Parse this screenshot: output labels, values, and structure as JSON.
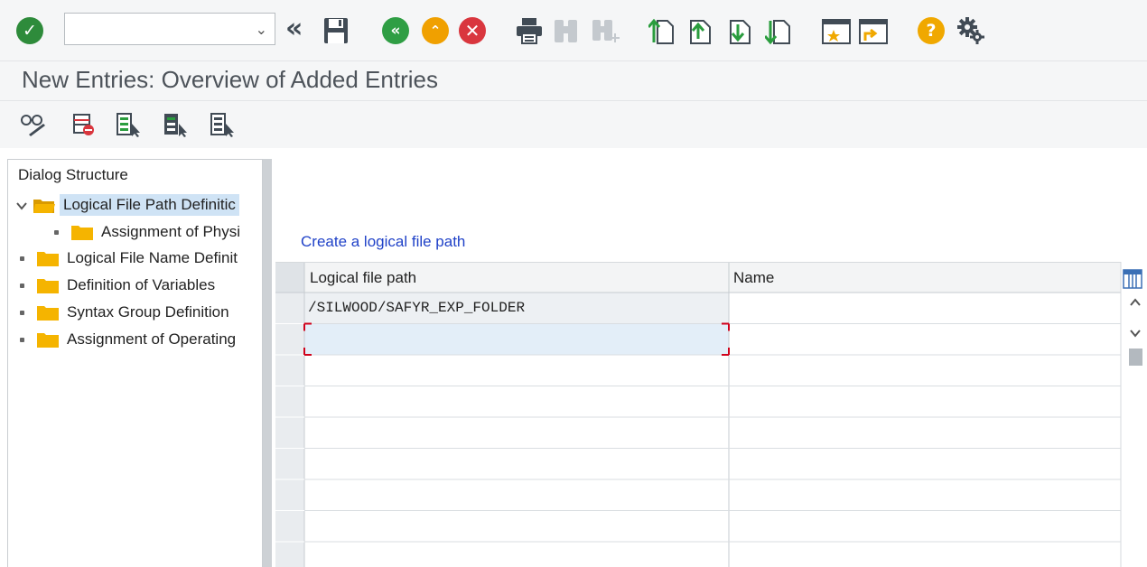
{
  "toolbar": {
    "command_field": {
      "value": "",
      "placeholder": ""
    },
    "icons": [
      "enter-icon",
      "double-chevron-left-icon",
      "save-icon",
      "back-icon",
      "exit-icon",
      "cancel-icon",
      "print-icon",
      "find-icon",
      "find-next-icon",
      "first-page-icon",
      "previous-page-icon",
      "next-page-icon",
      "last-page-icon",
      "create-session-icon",
      "generate-shortcut-icon",
      "help-icon",
      "settings-icon"
    ]
  },
  "title": "New Entries: Overview of Added Entries",
  "app_toolbar": {
    "icons": [
      "change-display-icon",
      "delete-icon",
      "select-all-icon",
      "select-block-icon",
      "deselect-all-icon"
    ]
  },
  "dialog_structure": {
    "header": "Dialog Structure",
    "items": [
      {
        "label": "Logical File Path Definitic",
        "level": 0,
        "expanded": true,
        "selected": true
      },
      {
        "label": "Assignment of Physi",
        "level": 1,
        "expanded": false,
        "selected": false
      },
      {
        "label": "Logical File Name Definit",
        "level": 0,
        "expanded": false,
        "selected": false
      },
      {
        "label": "Definition of Variables",
        "level": 0,
        "expanded": false,
        "selected": false
      },
      {
        "label": "Syntax Group Definition",
        "level": 0,
        "expanded": false,
        "selected": false
      },
      {
        "label": "Assignment of Operating",
        "level": 0,
        "expanded": false,
        "selected": false
      }
    ]
  },
  "table": {
    "caption": "Create a logical file path",
    "columns": [
      "Logical file path",
      "Name"
    ],
    "rows": [
      [
        "/SILWOOD/SAFYR_EXP_FOLDER",
        ""
      ],
      [
        "",
        ""
      ],
      [
        "",
        ""
      ],
      [
        "",
        ""
      ],
      [
        "",
        ""
      ],
      [
        "",
        ""
      ],
      [
        "",
        ""
      ],
      [
        "",
        ""
      ],
      [
        "",
        ""
      ]
    ]
  },
  "colors": {
    "enter_green": "#2e8b3b",
    "back_green": "#2f9e44",
    "exit_orange": "#f0a000",
    "cancel_red": "#d9363e",
    "help_orange": "#f0a800",
    "caption_blue": "#2042c8",
    "input_row_blue": "#e3eef8",
    "focus_red": "#d0021b",
    "folder_yellow": "#f5b400"
  }
}
